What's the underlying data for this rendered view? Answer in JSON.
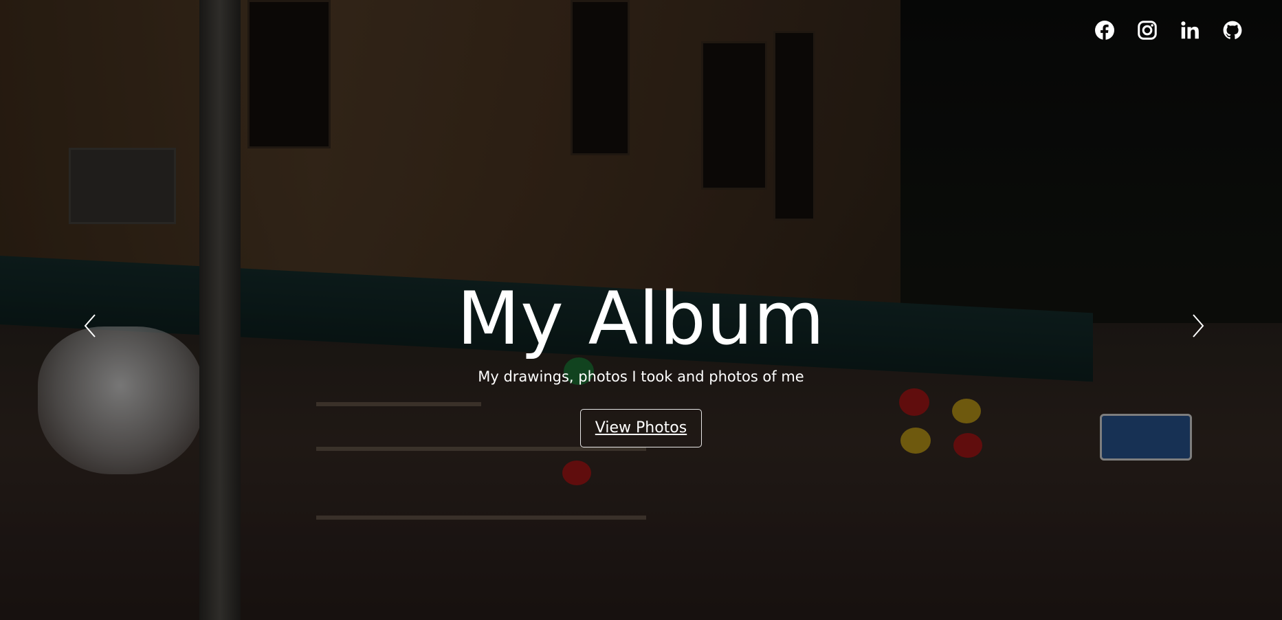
{
  "hero": {
    "title": "My Album",
    "subtitle": "My drawings, photos I took and photos of me",
    "cta_label": "View Photos"
  },
  "social": [
    {
      "name": "facebook-icon"
    },
    {
      "name": "instagram-icon"
    },
    {
      "name": "linkedin-icon"
    },
    {
      "name": "github-icon"
    }
  ],
  "carousel": {
    "prev_icon": "chevron-left-icon",
    "next_icon": "chevron-right-icon"
  },
  "colors": {
    "text": "#ffffff",
    "overlay": "rgba(0,0,0,0.45)"
  }
}
